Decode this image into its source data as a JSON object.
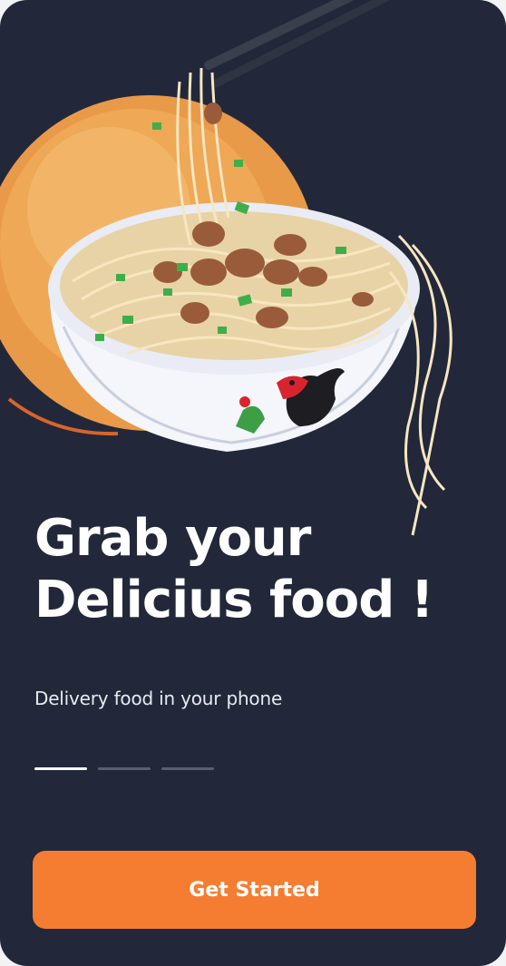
{
  "onboarding": {
    "headline_line1": "Grab your",
    "headline_line2": "Delicius food !",
    "subtitle": "Delivery food in your phone",
    "pager": {
      "total": 3,
      "active": 1
    },
    "cta_label": "Get Started"
  },
  "colors": {
    "background": "#22283a",
    "accent": "#f47d32",
    "text": "#ffffff"
  }
}
